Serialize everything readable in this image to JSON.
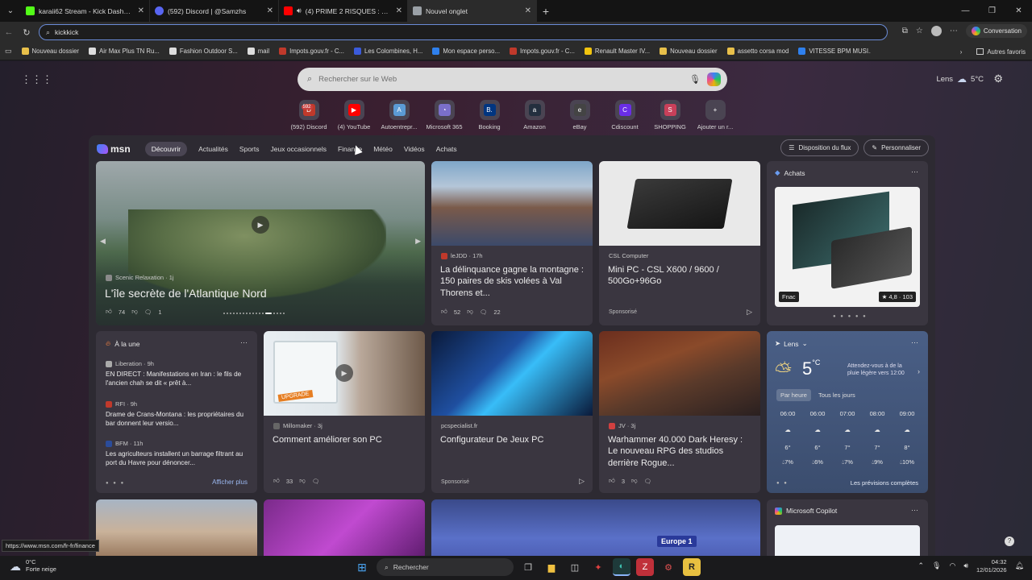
{
  "tabs": [
    {
      "title": "karaii62 Stream - Kick Dashboard",
      "color": "#53fc18"
    },
    {
      "title": "(592) Discord | @Samzhs",
      "color": "#5865f2"
    },
    {
      "title": "(4) PRIME 2 RISQUES : TONNE",
      "color": "#ff0000"
    },
    {
      "title": "Nouvel onglet",
      "color": "#9aa0a6"
    }
  ],
  "address": {
    "value": "kickkick"
  },
  "toolbar": {
    "copilot_label": "Conversation"
  },
  "bookmarks": [
    {
      "label": "Nouveau dossier",
      "color": "#e8c04a"
    },
    {
      "label": "Air Max Plus TN Ru...",
      "color": "#dddddd"
    },
    {
      "label": "Fashion Outdoor S...",
      "color": "#dddddd"
    },
    {
      "label": "mail",
      "color": "#dddddd"
    },
    {
      "label": "Impots.gouv.fr - C...",
      "color": "#c0392b"
    },
    {
      "label": "Les Colombines, H...",
      "color": "#3b5bdb"
    },
    {
      "label": "Mon espace perso...",
      "color": "#2f80ed"
    },
    {
      "label": "Impots.gouv.fr - C...",
      "color": "#c0392b"
    },
    {
      "label": "Renault Master IV...",
      "color": "#f1c40f"
    },
    {
      "label": "Nouveau dossier",
      "color": "#e8c04a"
    },
    {
      "label": "assetto corsa mod",
      "color": "#e8c04a"
    },
    {
      "label": "VITESSE BPM MUSI...",
      "color": "#2f80ed"
    }
  ],
  "bookmarks_other": "Autres favoris",
  "search": {
    "placeholder": "Rechercher sur le Web"
  },
  "weather_top": {
    "city": "Lens",
    "temp": "5°C"
  },
  "quicklinks": [
    {
      "label": "(592) Discord",
      "badge": "592",
      "color": "#c0392b",
      "glyph": "D"
    },
    {
      "label": "(4) YouTube",
      "color": "#ff0000",
      "glyph": "▶"
    },
    {
      "label": "Autoentrepr...",
      "color": "#5b9bd5",
      "glyph": "A"
    },
    {
      "label": "Microsoft 365",
      "color": "#7a6fc9",
      "glyph": "◔"
    },
    {
      "label": "Booking",
      "color": "#003580",
      "glyph": "B."
    },
    {
      "label": "Amazon",
      "color": "#232f3e",
      "glyph": "a"
    },
    {
      "label": "eBay",
      "color": "#444444",
      "glyph": "e"
    },
    {
      "label": "Cdiscount",
      "color": "#6a2ee6",
      "glyph": "C"
    },
    {
      "label": "SHOPPING",
      "color": "#c8405a",
      "glyph": "S"
    },
    {
      "label": "Ajouter un r...",
      "color": "#4a4452",
      "glyph": "+"
    }
  ],
  "feed": {
    "logo": "msn",
    "tabs": [
      "Découvrir",
      "Actualités",
      "Sports",
      "Jeux occasionnels",
      "Finance",
      "Météo",
      "Vidéos",
      "Achats"
    ],
    "actions": [
      "Disposition du flux",
      "Personnaliser"
    ],
    "hero": {
      "source": "Scenic Relaxation · 1j",
      "title": "L'île secrète de l'Atlantique Nord",
      "likes": "74",
      "comments": "1"
    },
    "card1": {
      "source": "leJDD · 17h",
      "title": "La délinquance gagne la montagne : 150 paires de skis volées à Val Thorens et...",
      "likes": "52",
      "comments": "22"
    },
    "card2": {
      "source": "CSL Computer",
      "title": "Mini PC - CSL X600 / 9600 / 500Go+96Go",
      "sponsored": "Sponsorisé"
    },
    "achats": {
      "title": "Achats",
      "store": "Fnac",
      "rating": "4,8 · 103"
    },
    "une": {
      "title": "À la une",
      "items": [
        {
          "source": "Liberation · 9h",
          "title": "EN DIRECT : Manifestations en Iran : le fils de l'ancien chah se dit « prêt à..."
        },
        {
          "source": "RFI · 9h",
          "title": "Drame de Crans-Montana : les propriétaires du bar donnent leur versio..."
        },
        {
          "source": "BFM · 11h",
          "title": "Les agriculteurs installent un barrage filtrant au port du Havre pour dénoncer..."
        }
      ],
      "more": "Afficher plus"
    },
    "card3": {
      "source": "Millomaker · 3j",
      "title": "Comment améliorer son PC",
      "likes": "33",
      "badge": "UPGRADE"
    },
    "card4": {
      "source": "pcspecialist.fr",
      "title": "Configurateur De Jeux PC",
      "sponsored": "Sponsorisé"
    },
    "card5": {
      "source": "JV · 3j",
      "title": "Warhammer 40.000 Dark Heresy : Le nouveau RPG des studios derrière Rogue...",
      "likes": "3"
    },
    "weather": {
      "city": "Lens",
      "temp": "5",
      "unit": "°C",
      "note": "Attendez-vous à de la pluie légère vers 12:00",
      "tab_hour": "Par heure",
      "tab_days": "Tous les jours",
      "hours": [
        {
          "time": "06:00",
          "temp": "6°",
          "rain": "7%"
        },
        {
          "time": "06:00",
          "temp": "6°",
          "rain": "6%"
        },
        {
          "time": "07:00",
          "temp": "7°",
          "rain": "7%"
        },
        {
          "time": "08:00",
          "temp": "7°",
          "rain": "9%"
        },
        {
          "time": "09:00",
          "temp": "8°",
          "rain": "10%"
        }
      ],
      "forecast_link": "Les prévisions complètes"
    },
    "copilot": {
      "title": "Microsoft Copilot"
    },
    "europe1": "Europe 1"
  },
  "status_url": "https://www.msn.com/fr-fr/finance",
  "taskbar": {
    "weather_temp": "0°C",
    "weather_desc": "Forte neige",
    "search": "Rechercher",
    "time": "04:32",
    "date": "12/01/2026"
  }
}
